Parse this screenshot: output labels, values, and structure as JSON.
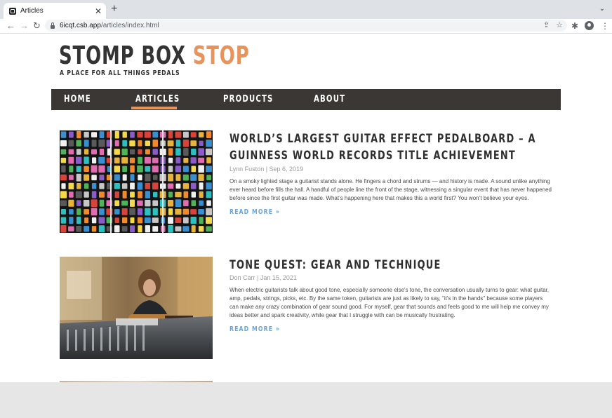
{
  "browser": {
    "tab_title": "Articles",
    "tab_close": "✕",
    "new_tab": "+",
    "tab_menu": "⌄",
    "url_host": "6icqt.csb.app",
    "url_path": "/articles/index.html",
    "back": "←",
    "forward": "→",
    "reload": "↻",
    "share": "⇪",
    "bookmark": "☆",
    "extensions": "✱",
    "more": "⋮"
  },
  "site": {
    "logo_main": "STOMP BOX",
    "logo_accent": "STOP",
    "tagline": "A PLACE FOR ALL THINGS PEDALS",
    "accent_color": "#e8935c",
    "nav_color": "#3a3734",
    "link_color": "#6ba5d7"
  },
  "nav": {
    "items": [
      {
        "label": "HOME",
        "active": false
      },
      {
        "label": "ARTICLES",
        "active": true
      },
      {
        "label": "PRODUCTS",
        "active": false
      },
      {
        "label": "ABOUT",
        "active": false
      }
    ]
  },
  "articles": [
    {
      "title": "WORLD’S LARGEST GUITAR EFFECT PEDALBOARD – A GUINNESS WORLD RECORDS TITLE ACHIEVEMENT",
      "meta": "Lynn Fuston | Sep 6, 2019",
      "excerpt": "On a smoky lighted stage a guitarist stands alone. He fingers a chord and strums — and history is made. A sound unlike anything ever heard before fills the hall. A handful of people line the front of the stage, witnessing a singular event that has never happened before since the first guitar was made. What’s happening here that makes this a world first? You won’t believe your eyes.",
      "read_more": "READ MORE »"
    },
    {
      "title": "TONE QUEST: GEAR AND TECHNIQUE",
      "meta": "Don Carr | Jan 15, 2021",
      "excerpt": "When electric guitarists talk about good tone, especially someone else's tone, the conversation usually turns to gear: what guitar, amp, pedals, strings, picks, etc. By the same token, guitarists are just as likely to say, \"it's in the hands\" because some players can make any crazy combination of gear sound good. For myself, gear that sounds and feels good to me will help me convey my ideas better and spark creativity, while gear that I struggle with can be musically frustrating.",
      "read_more": "READ MORE »"
    }
  ]
}
